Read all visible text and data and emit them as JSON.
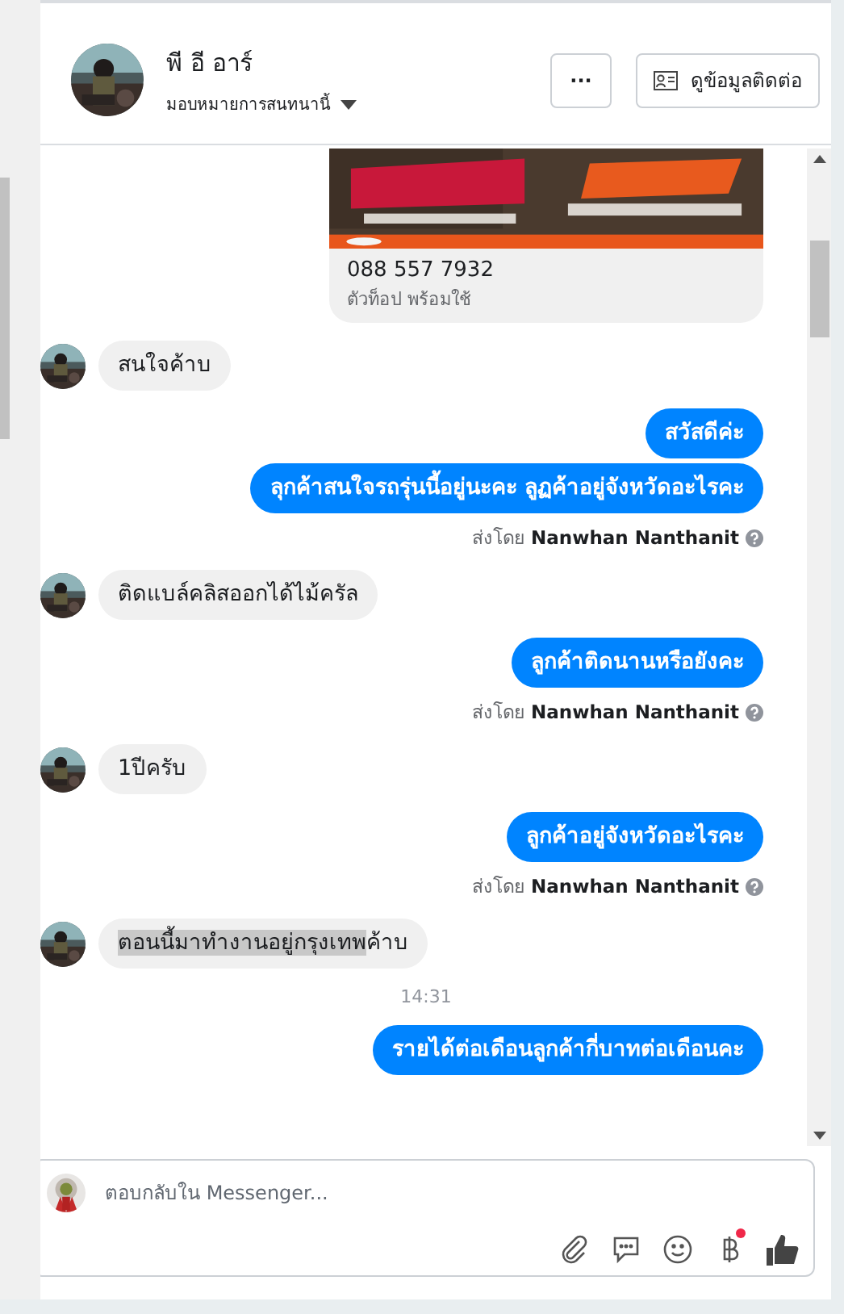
{
  "header": {
    "name": "พี อี อาร์",
    "assign_label": "มอบหมายการสนทนานี้",
    "more_button": "···",
    "contact_button": "ดูข้อมูลติดต่อ"
  },
  "thread": [
    {
      "kind": "card",
      "title": "088 557 7932",
      "subtitle": "ตัวท็อป พร้อมใช้"
    },
    {
      "kind": "incoming",
      "bubbles": [
        {
          "parts": [
            {
              "text": "สนใจค้าบ",
              "selected": false
            }
          ]
        }
      ]
    },
    {
      "kind": "outgoing",
      "bubbles": [
        {
          "parts": [
            {
              "text": "สวัสดีค่ะ",
              "selected": false
            }
          ]
        },
        {
          "parts": [
            {
              "text": "ลุกค้าสนใจรถรุ่นนี้อยู่นะคะ ลูฏค้าอยู่จังหวัดอะไรคะ",
              "selected": false
            }
          ]
        }
      ],
      "sent_by": {
        "prefix": "ส่งโดย",
        "name": "Nanwhan Nanthanit"
      }
    },
    {
      "kind": "incoming",
      "bubbles": [
        {
          "parts": [
            {
              "text": "ติดแบล์คลิสออกได้ไม้ครัล",
              "selected": false
            }
          ]
        }
      ]
    },
    {
      "kind": "outgoing",
      "bubbles": [
        {
          "parts": [
            {
              "text": "ลูกค้าติดนานหรือยังคะ",
              "selected": false
            }
          ]
        }
      ],
      "sent_by": {
        "prefix": "ส่งโดย",
        "name": "Nanwhan Nanthanit"
      }
    },
    {
      "kind": "incoming",
      "bubbles": [
        {
          "parts": [
            {
              "text": "1ปีครับ",
              "selected": false
            }
          ]
        }
      ]
    },
    {
      "kind": "outgoing",
      "bubbles": [
        {
          "parts": [
            {
              "text": "ลูกค้าอยู่จังหวัดอะไรคะ",
              "selected": false
            }
          ]
        }
      ],
      "sent_by": {
        "prefix": "ส่งโดย",
        "name": "Nanwhan Nanthanit"
      }
    },
    {
      "kind": "incoming",
      "bubbles": [
        {
          "parts": [
            {
              "text": "ตอนนี้มาทำงานอยู่กรุงเทพ",
              "selected": true
            },
            {
              "text": "ค้าบ",
              "selected": false
            }
          ]
        }
      ]
    },
    {
      "kind": "time",
      "text": "14:31"
    },
    {
      "kind": "outgoing",
      "bubbles": [
        {
          "parts": [
            {
              "text": "รายได้ต่อเดือนลูกค้ากี่บาทต่อเดือนคะ",
              "selected": false
            }
          ]
        }
      ]
    }
  ],
  "composer": {
    "placeholder": "ตอบกลับใน Messenger...",
    "payment_badge": true
  }
}
